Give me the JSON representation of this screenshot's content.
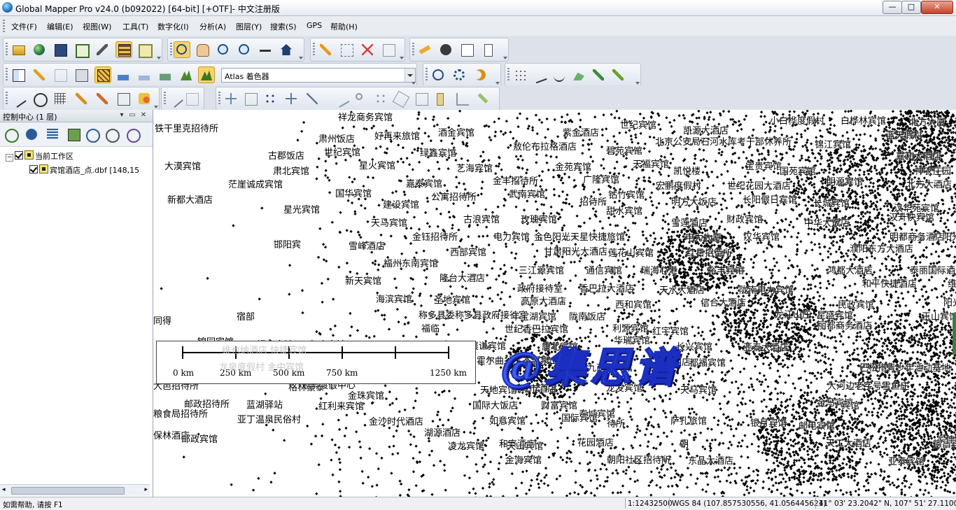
{
  "window": {
    "title": "Global Mapper Pro v24.0 (b092022) [64-bit] [+OTF]- 中文注册版",
    "minimize": "—",
    "maximize": "□",
    "close": "✕"
  },
  "menu": [
    "文件(F)",
    "编辑(E)",
    "视图(W)",
    "工具(T)",
    "数字化(I)",
    "分析(A)",
    "图层(Y)",
    "搜索(S)",
    "GPS",
    "帮助(H)"
  ],
  "toolbar": {
    "shader_select": "Atlas 着色器"
  },
  "control_center": {
    "title": "控制中心 (1 层)",
    "root_label": "当前工作区",
    "layer_label": "宾馆酒店_点.dbf [148,15"
  },
  "map": {
    "labels": [
      {
        "t": "祥龙商务宾馆"
      },
      {
        "t": "铁干里克招待所"
      },
      {
        "t": "肃州饭店"
      },
      {
        "t": "好再来旅馆"
      },
      {
        "t": "酒金宾馆"
      },
      {
        "t": "紫金酒店"
      },
      {
        "t": "世纪宾馆"
      },
      {
        "t": "凯源大酒店"
      },
      {
        "t": "小白桦度假村"
      },
      {
        "t": "白桦林宾馆"
      },
      {
        "t": "北方大厦"
      },
      {
        "t": "古郡饭店"
      },
      {
        "t": "世纪宾馆"
      },
      {
        "t": "绿鑫宾馆"
      },
      {
        "t": "敖伦布拉格酒店"
      },
      {
        "t": "碧苑宾馆"
      },
      {
        "t": "北京公安局石河水库考干部休养所"
      },
      {
        "t": "锦江宾馆"
      },
      {
        "t": "蓝天假村"
      },
      {
        "t": "大漠宾馆"
      },
      {
        "t": "肃北宾馆"
      },
      {
        "t": "星火宾馆"
      },
      {
        "t": "艺海宾馆"
      },
      {
        "t": "金苑宾馆"
      },
      {
        "t": "天福宾馆"
      },
      {
        "t": "凯悦楼"
      },
      {
        "t": "宝贵宾馆"
      },
      {
        "t": "国苑宾馆"
      },
      {
        "t": "嘉利大酒店"
      },
      {
        "t": "神农庄园"
      },
      {
        "t": "茫崖诚成宾馆"
      },
      {
        "t": "嘉泰宾馆"
      },
      {
        "t": "金丰招待所"
      },
      {
        "t": "广隆宾馆"
      },
      {
        "t": "宏鹏度假村"
      },
      {
        "t": "世纪花园大酒店"
      },
      {
        "t": "明源宾馆"
      },
      {
        "t": "北方大酒店"
      },
      {
        "t": "国华宾馆"
      },
      {
        "t": "公寓招待所"
      },
      {
        "t": "武南宾馆"
      },
      {
        "t": "钻竹宾馆"
      },
      {
        "t": "新都大酒店"
      },
      {
        "t": "建设宾馆"
      },
      {
        "t": "招待所"
      },
      {
        "t": "明方大饭店"
      },
      {
        "t": "长阳假日宾馆"
      },
      {
        "t": "长城宾馆"
      },
      {
        "t": "汉华苑宾馆"
      },
      {
        "t": "星光宾馆"
      },
      {
        "t": "甜水宾馆"
      },
      {
        "t": "天马宾馆"
      },
      {
        "t": "古浪宾馆"
      },
      {
        "t": "玫瑰宾馆"
      },
      {
        "t": "雪莲酒店"
      },
      {
        "t": "财政宾馆"
      },
      {
        "t": "中华大饭店"
      },
      {
        "t": "汉升快宾馆"
      },
      {
        "t": "金钰招待所"
      },
      {
        "t": "电力宾馆"
      },
      {
        "t": "金色阳光天星快捷旅馆"
      },
      {
        "t": "电力大厦"
      },
      {
        "t": "汉华宾馆"
      },
      {
        "t": "明都商务酒店"
      },
      {
        "t": "阳光宾馆"
      },
      {
        "t": "邯阳宾"
      },
      {
        "t": "雪峰酒店"
      },
      {
        "t": "西部宾馆"
      },
      {
        "t": "甘肃阳光大酒店"
      },
      {
        "t": "莲花山宾馆"
      },
      {
        "t": "红日招待所"
      },
      {
        "t": "濮阳东方大酒店"
      },
      {
        "t": "福州东南宾馆"
      },
      {
        "t": "三江源宾馆"
      },
      {
        "t": "通信宾馆"
      },
      {
        "t": "瑞海心港"
      },
      {
        "t": "裕丰宾馆"
      },
      {
        "t": "鸿都大酒店"
      },
      {
        "t": "泰丽国际酒店"
      },
      {
        "t": "新天宾馆"
      },
      {
        "t": "隆台大酒店"
      },
      {
        "t": "政府接待室"
      },
      {
        "t": "香巴拉大酒店"
      },
      {
        "t": "天水大酒店"
      },
      {
        "t": "陇南电力宾馆"
      },
      {
        "t": "和平快捷酒店"
      },
      {
        "t": "维也纳宾馆"
      },
      {
        "t": "海滨宾馆"
      },
      {
        "t": "圣地宾馆"
      },
      {
        "t": "高原大酒店"
      },
      {
        "t": "西和宾馆"
      },
      {
        "t": "信合大酒店"
      },
      {
        "t": "民政宾馆"
      },
      {
        "t": "阳光宾馆"
      },
      {
        "t": "同得"
      },
      {
        "t": "宿部"
      },
      {
        "t": "称多县委称多县政府接待室"
      },
      {
        "t": "年宝湖宾馆"
      },
      {
        "t": "陇南饭店"
      },
      {
        "t": "龙江山庄"
      },
      {
        "t": "星盛宾馆"
      },
      {
        "t": "玉山宾馆"
      },
      {
        "t": "福临"
      },
      {
        "t": "世纪香巴拉宾馆"
      },
      {
        "t": "利源宾馆"
      },
      {
        "t": "红宇宾馆"
      },
      {
        "t": "丽都商务酒店"
      },
      {
        "t": "金楼大酒店"
      },
      {
        "t": "锦园宾馆"
      },
      {
        "t": "银鑫宾馆"
      },
      {
        "t": "年丰宾馆"
      },
      {
        "t": "襄谦宾馆"
      },
      {
        "t": "康北宾馆"
      },
      {
        "t": "华瑞宾馆"
      },
      {
        "t": "长兴宾馆"
      },
      {
        "t": "亚泰大酒店"
      },
      {
        "t": "天都宾馆大酒店"
      },
      {
        "t": "叶绿饭店"
      },
      {
        "t": "电信宾馆"
      },
      {
        "t": "当雄招待所"
      },
      {
        "t": "霍尔曲谷生态温泉山庄"
      },
      {
        "t": "京九商务宾馆"
      },
      {
        "t": "富桥大酒店"
      },
      {
        "t": "都福宾馆"
      },
      {
        "t": "巴松措青少年活动基地"
      },
      {
        "t": "温泉渡假中心"
      },
      {
        "t": "大邑招待所"
      },
      {
        "t": "格林豪泰"
      },
      {
        "t": "天地宾馆"
      },
      {
        "t": "新城市酒店"
      },
      {
        "t": "龙发宾馆"
      },
      {
        "t": "天马宾馆"
      },
      {
        "t": "大河边老字号雪鱼庄"
      },
      {
        "t": "金珠宾馆"
      },
      {
        "t": "邮政招待所"
      },
      {
        "t": "蓝湖驿站"
      },
      {
        "t": "红利来宾馆"
      },
      {
        "t": "国际大饭店"
      },
      {
        "t": "财富宾馆"
      },
      {
        "t": "泰城宾馆"
      },
      {
        "t": "金马宾馆"
      },
      {
        "t": "宾馆"
      },
      {
        "t": "粮食局招待所"
      },
      {
        "t": "亚丁温泉民俗村"
      },
      {
        "t": "金沙时代酒店"
      },
      {
        "t": "如意宾馆"
      },
      {
        "t": "国际宾馆"
      },
      {
        "t": "萨孔旅馆"
      },
      {
        "t": "保林酒店"
      },
      {
        "t": "邮政宾馆"
      },
      {
        "t": "湖源酒店"
      },
      {
        "t": "待所"
      },
      {
        "t": "银月宾馆"
      },
      {
        "t": "邮电宾馆"
      },
      {
        "t": "德昌宾馆"
      },
      {
        "t": "和泰酒店"
      },
      {
        "t": "凌龙宾馆"
      },
      {
        "t": "天山宾馆"
      },
      {
        "t": "花园酒店"
      },
      {
        "t": "朝"
      },
      {
        "t": "天工大酒店"
      },
      {
        "t": "家佳宾馆"
      },
      {
        "t": "金海宾馆"
      },
      {
        "t": "朝阳社区招待所"
      },
      {
        "t": "东晶大酒店"
      },
      {
        "t": "亚泰宾馆"
      }
    ]
  },
  "scalebar": {
    "ticks": [
      "0 km",
      "250 km",
      "500 km",
      "750 km",
      "1250 km"
    ]
  },
  "watermark": {
    "text": "@集思谱",
    "ghost_line1": "维也纳酒店  快捷宾馆",
    "ghost_line2": "龙泉度假村  金中宾馆"
  },
  "status": {
    "help": "如需帮助, 请按 F1",
    "scale": "1:12432500",
    "projection": "WGS 84 (107.857530556, 41.056445621)",
    "coords": "41° 03' 23.2042\" N, 107° 51' 27.1100\" E"
  },
  "colors": {
    "accent_active": "#f7d36a",
    "watermark_fill": "#3e5ef0",
    "window_bg": "#dfe3ea"
  }
}
